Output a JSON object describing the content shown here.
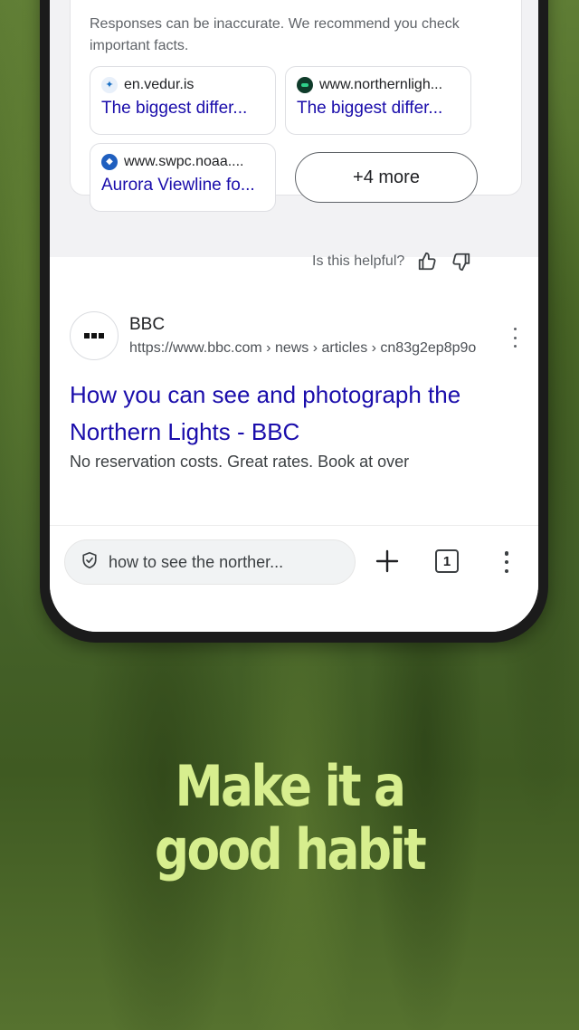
{
  "colors": {
    "headline": "#d7ee8e",
    "link": "#1a0dab",
    "background_green": "#4d6b28"
  },
  "ai_overview": {
    "disclaimer": "Responses can be inaccurate. We recommend you check important facts.",
    "sources": [
      {
        "domain": "en.vedur.is",
        "title": "The biggest differ...",
        "icon": "vedur-favicon"
      },
      {
        "domain": "www.northernligh...",
        "title": "The biggest differ...",
        "icon": "northern-lights-favicon"
      },
      {
        "domain": "www.swpc.noaa....",
        "title": "Aurora Viewline fo...",
        "icon": "noaa-favicon"
      }
    ],
    "more_label": "+4 more",
    "helpful_prompt": "Is this helpful?"
  },
  "result": {
    "site_name": "BBC",
    "url": "https://www.bbc.com › news › articles › cn83g2ep8p9o",
    "title": "How you can see and photograph the Northern Lights - BBC",
    "snippet": "No reservation costs. Great rates. Book at over"
  },
  "bottom_bar": {
    "query": "how to see the norther...",
    "tab_count": "1"
  },
  "headline": {
    "line1": "Make it a",
    "line2": "good habit"
  }
}
